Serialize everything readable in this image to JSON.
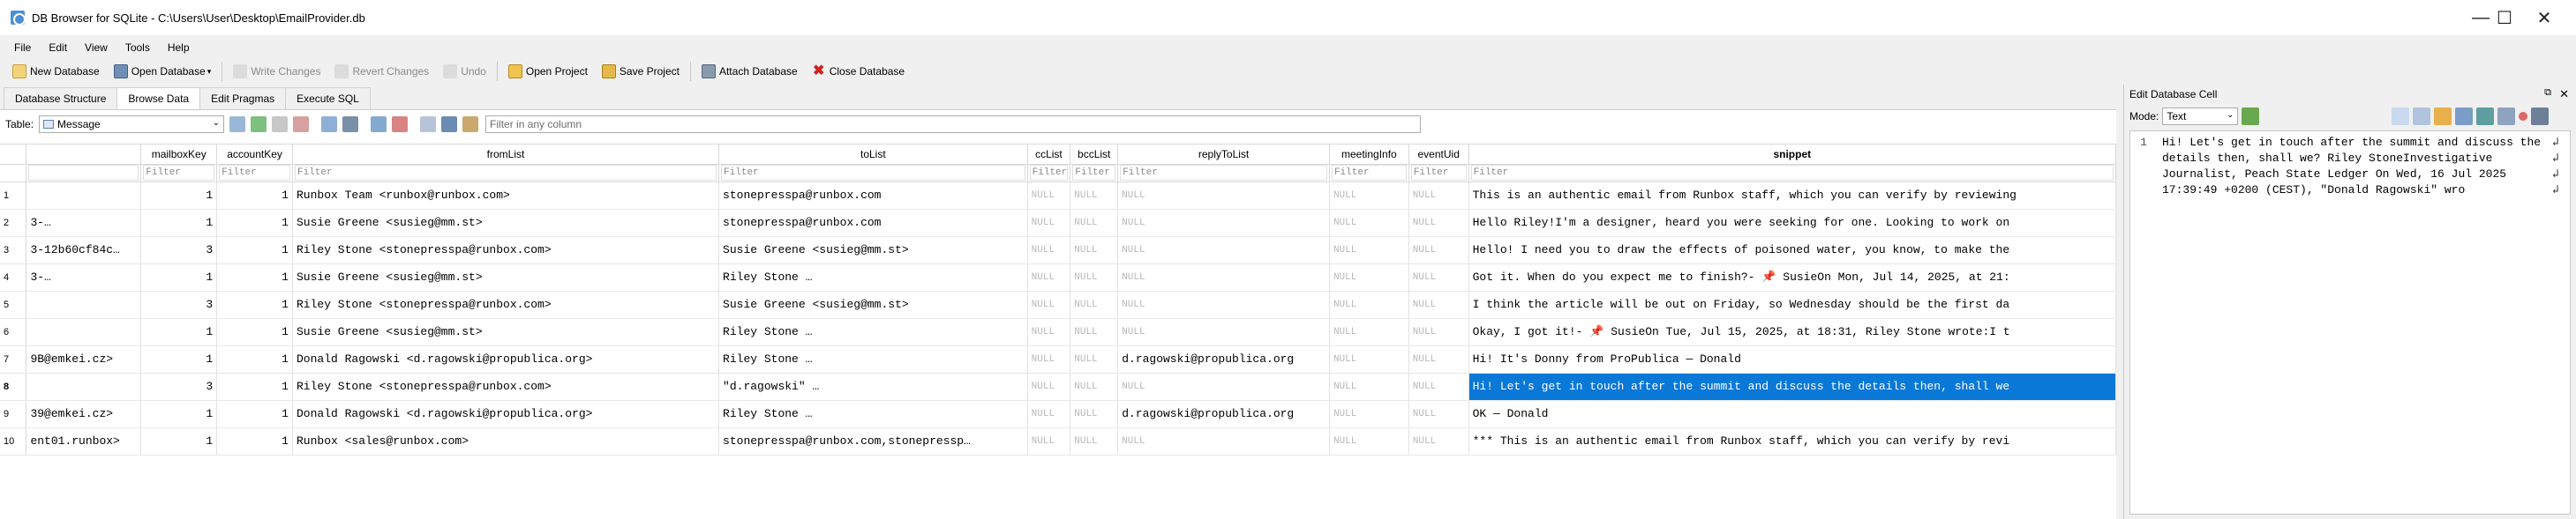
{
  "window": {
    "title": "DB Browser for SQLite - C:\\Users\\User\\Desktop\\EmailProvider.db",
    "minimize": "—",
    "maximize": "☐",
    "close": "✕"
  },
  "menu": [
    "File",
    "Edit",
    "View",
    "Tools",
    "Help"
  ],
  "toolbar": {
    "new_database": "New Database",
    "open_database": "Open Database",
    "write_changes": "Write Changes",
    "revert_changes": "Revert Changes",
    "undo": "Undo",
    "open_project": "Open Project",
    "save_project": "Save Project",
    "attach_database": "Attach Database",
    "close_database": "Close Database"
  },
  "tabs": [
    "Database Structure",
    "Browse Data",
    "Edit Pragmas",
    "Execute SQL"
  ],
  "filterbar": {
    "table_label": "Table:",
    "table_value": "Message",
    "filter_placeholder": "Filter in any column"
  },
  "columns": [
    "mailboxKey",
    "accountKey",
    "fromList",
    "toList",
    "ccList",
    "bccList",
    "replyToList",
    "meetingInfo",
    "eventUid",
    "snippet"
  ],
  "filter_text": "Filter",
  "rows": [
    {
      "rownum": "1",
      "c0": "",
      "mailboxKey": "1",
      "accountKey": "1",
      "fromList": "Runbox Team <runbox@runbox.com>",
      "toList": "stonepresspa@runbox.com",
      "ccList": "NULL",
      "bccList": "NULL",
      "replyToList": "NULL",
      "meetingInfo": "NULL",
      "eventUid": "NULL",
      "snippet": "This is an authentic email from Runbox staff, which you can verify by reviewing"
    },
    {
      "rownum": "2",
      "c0": "3-…",
      "mailboxKey": "1",
      "accountKey": "1",
      "fromList": "Susie Greene <susieg@mm.st>",
      "toList": "stonepresspa@runbox.com",
      "ccList": "NULL",
      "bccList": "NULL",
      "replyToList": "NULL",
      "meetingInfo": "NULL",
      "eventUid": "NULL",
      "snippet": "Hello Riley!I'm a designer, heard you were seeking for one. Looking to work on"
    },
    {
      "rownum": "3",
      "c0": "3-12b60cf84c…",
      "mailboxKey": "3",
      "accountKey": "1",
      "fromList": "Riley Stone <stonepresspa@runbox.com>",
      "toList": "Susie Greene <susieg@mm.st>",
      "ccList": "NULL",
      "bccList": "NULL",
      "replyToList": "NULL",
      "meetingInfo": "NULL",
      "eventUid": "NULL",
      "snippet": "Hello! I need you to draw the effects of poisoned water, you know, to make the"
    },
    {
      "rownum": "4",
      "c0": "3-…",
      "mailboxKey": "1",
      "accountKey": "1",
      "fromList": "Susie Greene <susieg@mm.st>",
      "toList": "Riley Stone …",
      "ccList": "NULL",
      "bccList": "NULL",
      "replyToList": "NULL",
      "meetingInfo": "NULL",
      "eventUid": "NULL",
      "snippet": "Got it. When do you expect me to finish?- 📌 SusieOn Mon, Jul 14, 2025, at 21:"
    },
    {
      "rownum": "5",
      "c0": "",
      "mailboxKey": "3",
      "accountKey": "1",
      "fromList": "Riley Stone <stonepresspa@runbox.com>",
      "toList": "Susie Greene <susieg@mm.st>",
      "ccList": "NULL",
      "bccList": "NULL",
      "replyToList": "NULL",
      "meetingInfo": "NULL",
      "eventUid": "NULL",
      "snippet": "I think the article will be out on Friday, so Wednesday should be the first da"
    },
    {
      "rownum": "6",
      "c0": "",
      "mailboxKey": "1",
      "accountKey": "1",
      "fromList": "Susie Greene <susieg@mm.st>",
      "toList": "Riley Stone …",
      "ccList": "NULL",
      "bccList": "NULL",
      "replyToList": "NULL",
      "meetingInfo": "NULL",
      "eventUid": "NULL",
      "snippet": "Okay, I got it!- 📌 SusieOn Tue, Jul 15, 2025, at 18:31, Riley Stone wrote:I t"
    },
    {
      "rownum": "7",
      "c0": "9B@emkei.cz>",
      "mailboxKey": "1",
      "accountKey": "1",
      "fromList": "Donald Ragowski <d.ragowski@propublica.org>",
      "toList": "Riley Stone …",
      "ccList": "NULL",
      "bccList": "NULL",
      "replyToList": "d.ragowski@propublica.org",
      "meetingInfo": "NULL",
      "eventUid": "NULL",
      "snippet": "Hi! It's Donny from ProPublica — Donald"
    },
    {
      "rownum": "8",
      "c0": "",
      "mailboxKey": "3",
      "accountKey": "1",
      "fromList": "Riley Stone <stonepresspa@runbox.com>",
      "toList": "\"d.ragowski\" …",
      "ccList": "NULL",
      "bccList": "NULL",
      "replyToList": "NULL",
      "meetingInfo": "NULL",
      "eventUid": "NULL",
      "snippet": "Hi! Let's get in touch after the summit and discuss the details then, shall we",
      "selected": true
    },
    {
      "rownum": "9",
      "c0": "39@emkei.cz>",
      "mailboxKey": "1",
      "accountKey": "1",
      "fromList": "Donald Ragowski <d.ragowski@propublica.org>",
      "toList": "Riley Stone …",
      "ccList": "NULL",
      "bccList": "NULL",
      "replyToList": "d.ragowski@propublica.org",
      "meetingInfo": "NULL",
      "eventUid": "NULL",
      "snippet": "OK — Donald"
    },
    {
      "rownum": "10",
      "c0": "ent01.runbox>",
      "mailboxKey": "1",
      "accountKey": "1",
      "fromList": "Runbox <sales@runbox.com>",
      "toList": "stonepresspa@runbox.com,stonepressp…",
      "ccList": "NULL",
      "bccList": "NULL",
      "replyToList": "NULL",
      "meetingInfo": "NULL",
      "eventUid": "NULL",
      "snippet": "*** This is an authentic email from Runbox staff, which you can verify by revi"
    }
  ],
  "edit_cell": {
    "title": "Edit Database Cell",
    "mode_label": "Mode:",
    "mode_value": "Text",
    "line_number": "1",
    "content": "Hi! Let's get in touch after the summit and discuss the details then, shall we? Riley StoneInvestigative Journalist, Peach State Ledger On Wed, 16 Jul 2025 17:39:49 +0200 (CEST), \"Donald Ragowski\" wro"
  },
  "colors": {
    "selection": "#0a78d7",
    "null_text": "#b8b8b8"
  }
}
